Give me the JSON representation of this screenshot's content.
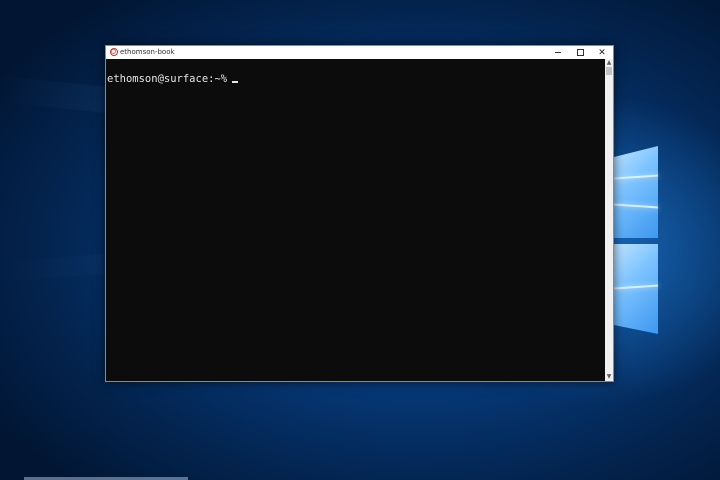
{
  "window": {
    "title": "ethomson-book",
    "icon": "debian-swirl-icon",
    "controls": {
      "minimize": "minimize-icon",
      "maximize": "maximize-icon",
      "close": "✕"
    }
  },
  "terminal": {
    "prompt": "ethomson@surface:~%",
    "background": "#0c0c0c",
    "foreground": "#e6e6e6"
  },
  "scrollbar": {
    "up_glyph": "▲",
    "down_glyph": "▼"
  },
  "desktop": {
    "wallpaper": "windows-10-hero",
    "accent": "#0b4f9c"
  }
}
